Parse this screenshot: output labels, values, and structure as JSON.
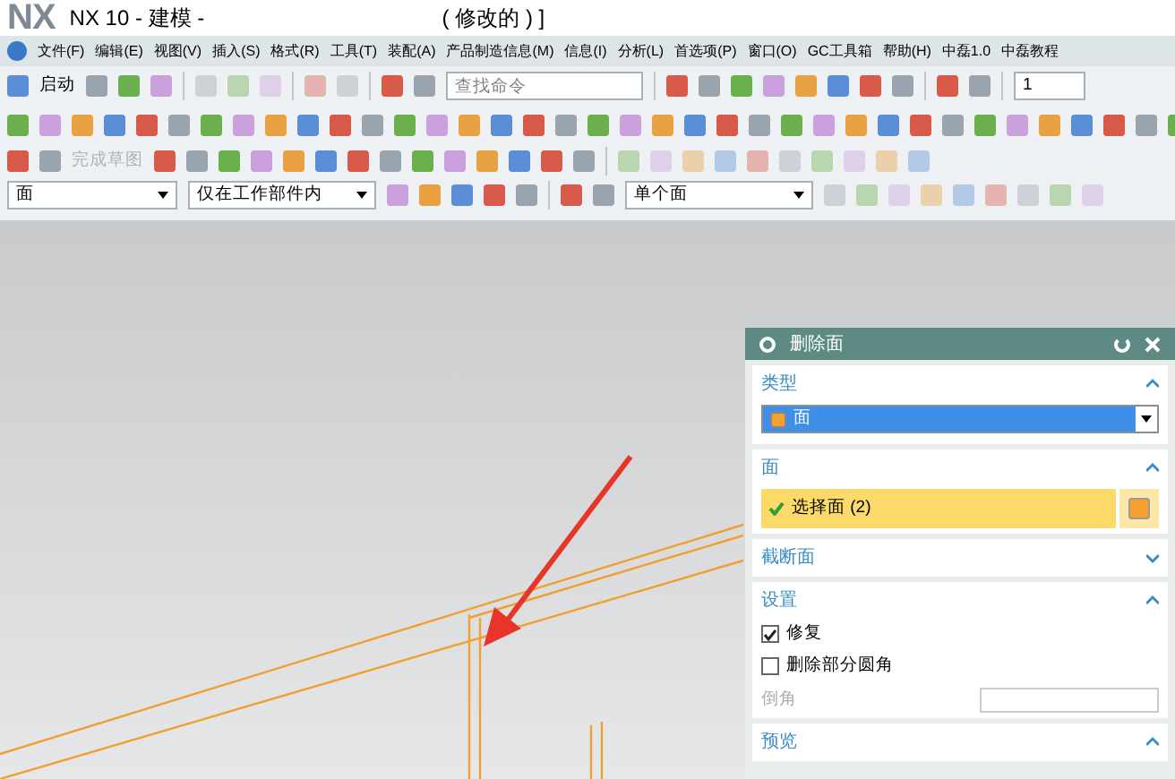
{
  "window": {
    "logo": "NX",
    "title": "NX 10 - 建模 -",
    "status": "( 修改的 ) ]"
  },
  "menu": [
    "文件(F)",
    "编辑(E)",
    "视图(V)",
    "插入(S)",
    "格式(R)",
    "工具(T)",
    "装配(A)",
    "产品制造信息(M)",
    "信息(I)",
    "分析(L)",
    "首选项(P)",
    "窗口(O)",
    "GC工具箱",
    "帮助(H)",
    "中磊1.0",
    "中磊教程"
  ],
  "toolbar": {
    "start_label": "启动",
    "search": {
      "placeholder": "查找命令"
    },
    "layer_value": "1",
    "sketch_finish": {
      "label": "完成草图",
      "disabled": true
    }
  },
  "selection_bar": {
    "filter": "面",
    "scope": "仅在工作部件内",
    "rule": "单个面"
  },
  "dialog": {
    "title": "删除面",
    "sections": [
      {
        "kind": "dropdown",
        "label": "类型",
        "expanded": true,
        "value": "面"
      },
      {
        "kind": "selection",
        "label": "面",
        "expanded": true,
        "value": "选择面 (2)"
      },
      {
        "label": "截断面",
        "expanded": false
      },
      {
        "kind": "settings",
        "label": "设置",
        "expanded": true,
        "options": [
          {
            "label": "修复",
            "checked": true
          },
          {
            "label": "删除部分圆角",
            "checked": false
          }
        ],
        "field_label": "倒角"
      },
      {
        "label": "预览",
        "expanded": true
      }
    ]
  }
}
